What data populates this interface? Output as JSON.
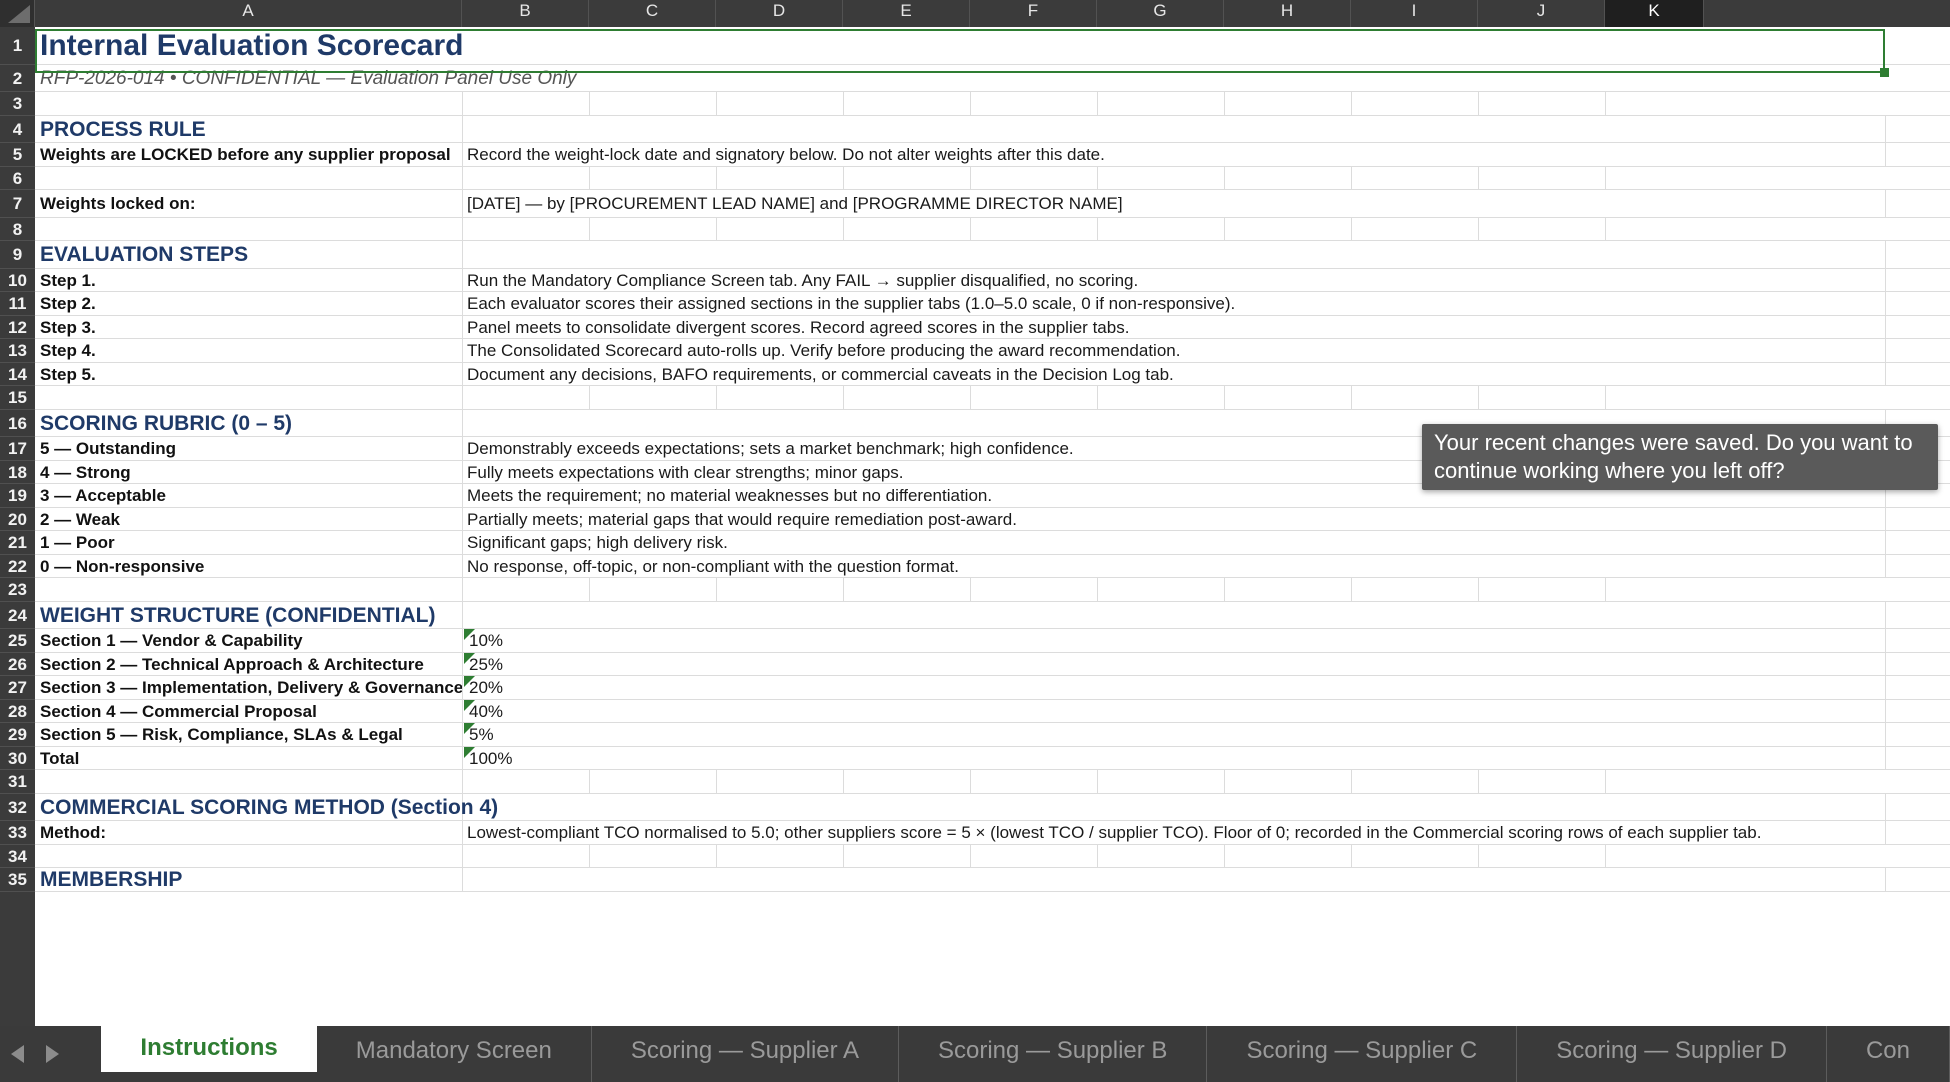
{
  "columns": [
    "A",
    "B",
    "C",
    "D",
    "E",
    "F",
    "G",
    "H",
    "I",
    "J",
    "K"
  ],
  "title": "Internal Evaluation Scorecard",
  "subtitle": "RFP-2026-014  •  CONFIDENTIAL — Evaluation Panel Use Only",
  "rows": [
    {
      "n": "1"
    },
    {
      "n": "2"
    },
    {
      "n": "3"
    },
    {
      "n": "4"
    },
    {
      "n": "5"
    },
    {
      "n": "6"
    },
    {
      "n": "7"
    },
    {
      "n": "8"
    },
    {
      "n": "9"
    },
    {
      "n": "10"
    },
    {
      "n": "11"
    },
    {
      "n": "12"
    },
    {
      "n": "13"
    },
    {
      "n": "14"
    },
    {
      "n": "15"
    },
    {
      "n": "16"
    },
    {
      "n": "17"
    },
    {
      "n": "18"
    },
    {
      "n": "19"
    },
    {
      "n": "20"
    },
    {
      "n": "21"
    },
    {
      "n": "22"
    },
    {
      "n": "23"
    },
    {
      "n": "24"
    },
    {
      "n": "25"
    },
    {
      "n": "26"
    },
    {
      "n": "27"
    },
    {
      "n": "28"
    },
    {
      "n": "29"
    },
    {
      "n": "30"
    },
    {
      "n": "31"
    },
    {
      "n": "32"
    },
    {
      "n": "33"
    },
    {
      "n": "34"
    },
    {
      "n": "35"
    }
  ],
  "process_rule": {
    "heading": "PROCESS RULE",
    "r5_a": "Weights are LOCKED before any supplier proposal",
    "r5_b": "Record the weight-lock date and signatory below. Do not alter weights after this date.",
    "r7_a": "Weights locked on:",
    "r7_b": "[DATE] — by [PROCUREMENT LEAD NAME] and [PROGRAMME DIRECTOR NAME]"
  },
  "evaluation_steps": {
    "heading": "EVALUATION STEPS",
    "items": [
      {
        "label": "Step 1.",
        "text": "Run the Mandatory Compliance Screen tab. Any FAIL → supplier disqualified, no scoring."
      },
      {
        "label": "Step 2.",
        "text": "Each evaluator scores their assigned sections in the supplier tabs (1.0–5.0 scale, 0 if non-responsive)."
      },
      {
        "label": "Step 3.",
        "text": "Panel meets to consolidate divergent scores. Record agreed scores in the supplier tabs."
      },
      {
        "label": "Step 4.",
        "text": "The Consolidated Scorecard auto-rolls up. Verify before producing the award recommendation."
      },
      {
        "label": "Step 5.",
        "text": "Document any decisions, BAFO requirements, or commercial caveats in the Decision Log tab."
      }
    ]
  },
  "rubric": {
    "heading": "SCORING RUBRIC (0 – 5)",
    "items": [
      {
        "label": "5 — Outstanding",
        "text": "Demonstrably exceeds expectations; sets a market benchmark; high confidence."
      },
      {
        "label": "4 — Strong",
        "text": "Fully meets expectations with clear strengths; minor gaps."
      },
      {
        "label": "3 — Acceptable",
        "text": "Meets the requirement; no material weaknesses but no differentiation."
      },
      {
        "label": "2 — Weak",
        "text": "Partially meets; material gaps that would require remediation post-award."
      },
      {
        "label": "1 — Poor",
        "text": "Significant gaps; high delivery risk."
      },
      {
        "label": "0 — Non-responsive",
        "text": "No response, off-topic, or non-compliant with the question format."
      }
    ]
  },
  "weights": {
    "heading": "WEIGHT STRUCTURE (CONFIDENTIAL)",
    "items": [
      {
        "label": "Section 1 — Vendor & Capability",
        "value": "10%"
      },
      {
        "label": "Section 2 — Technical Approach & Architecture",
        "value": "25%"
      },
      {
        "label": "Section 3 — Implementation, Delivery & Governance",
        "value": "20%"
      },
      {
        "label": "Section 4 — Commercial Proposal",
        "value": "40%"
      },
      {
        "label": "Section 5 — Risk, Compliance, SLAs & Legal",
        "value": "5%"
      },
      {
        "label": "Total",
        "value": "100%"
      }
    ]
  },
  "commercial": {
    "heading": "COMMERCIAL SCORING METHOD (Section 4)",
    "method_label": "Method:",
    "method_text": "Lowest-compliant TCO normalised to 5.0; other suppliers score = 5 × (lowest TCO / supplier TCO). Floor of 0; recorded in the Commercial scoring rows of each supplier tab."
  },
  "partial_heading": "MEMBERSHIP",
  "toast": "Your recent changes were saved. Do you want to continue working where you left off?",
  "tabs": [
    {
      "label": "Instructions",
      "active": true
    },
    {
      "label": "Mandatory Screen"
    },
    {
      "label": "Scoring — Supplier A"
    },
    {
      "label": "Scoring — Supplier B"
    },
    {
      "label": "Scoring — Supplier C"
    },
    {
      "label": "Scoring — Supplier D"
    },
    {
      "label": "Con"
    }
  ],
  "colors": {
    "accent": "#2e7d32",
    "heading": "#1f3a68"
  }
}
